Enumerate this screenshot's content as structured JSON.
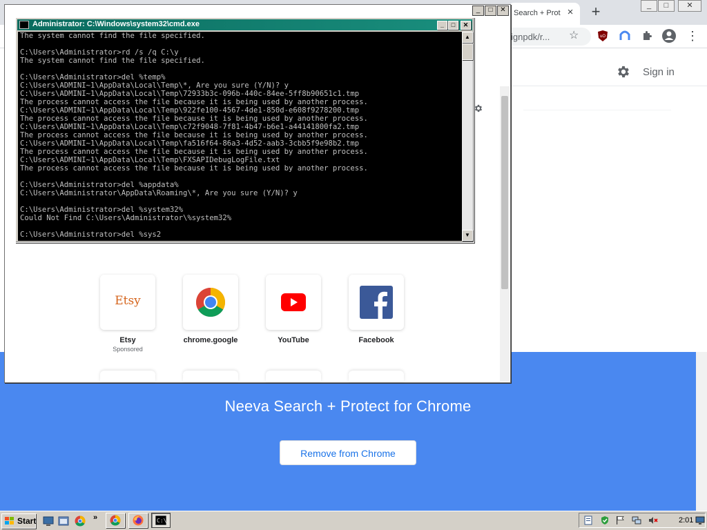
{
  "chrome": {
    "active_tab_title": "Search + Prot",
    "omnibox_text": "ignpdk/r...",
    "signin_label": "Sign in",
    "window_buttons": [
      "_",
      "□",
      "✕"
    ],
    "new_tab": "+"
  },
  "inner_window": {
    "window_buttons": [
      "_",
      "□",
      "✕"
    ],
    "shortcuts": [
      {
        "label": "Etsy",
        "sub": "Sponsored",
        "logo_text": "Etsy"
      },
      {
        "label": "chrome.google",
        "sub": ""
      },
      {
        "label": "YouTube",
        "sub": ""
      },
      {
        "label": "Facebook",
        "sub": ""
      }
    ]
  },
  "banner": {
    "title": "Neeva Search + Protect for Chrome",
    "remove_button": "Remove from Chrome",
    "color": "#4a88f0"
  },
  "cmd": {
    "title": "Administrator: C:\\Windows\\system32\\cmd.exe",
    "lines": [
      "The system cannot find the file specified.",
      "",
      "C:\\Users\\Administrator>rd /s /q C:\\y",
      "The system cannot find the file specified.",
      "",
      "C:\\Users\\Administrator>del %temp%",
      "C:\\Users\\ADMINI~1\\AppData\\Local\\Temp\\*, Are you sure (Y/N)? y",
      "C:\\Users\\ADMINI~1\\AppData\\Local\\Temp\\72933b3c-096b-440c-84ee-5ff8b90651c1.tmp",
      "The process cannot access the file because it is being used by another process.",
      "C:\\Users\\ADMINI~1\\AppData\\Local\\Temp\\922fe100-4567-4de1-850d-e608f9278200.tmp",
      "The process cannot access the file because it is being used by another process.",
      "C:\\Users\\ADMINI~1\\AppData\\Local\\Temp\\c72f9048-7f81-4b47-b6e1-a44141800fa2.tmp",
      "The process cannot access the file because it is being used by another process.",
      "C:\\Users\\ADMINI~1\\AppData\\Local\\Temp\\fa516f64-86a3-4d52-aab3-3cbb5f9e98b2.tmp",
      "The process cannot access the file because it is being used by another process.",
      "C:\\Users\\ADMINI~1\\AppData\\Local\\Temp\\FXSAPIDebugLogFile.txt",
      "The process cannot access the file because it is being used by another process.",
      "",
      "C:\\Users\\Administrator>del %appdata%",
      "C:\\Users\\Administrator\\AppData\\Roaming\\*, Are you sure (Y/N)? y",
      "",
      "C:\\Users\\Administrator>del %system32%",
      "Could Not Find C:\\Users\\Administrator\\%system32%",
      "",
      "C:\\Users\\Administrator>del %sys2"
    ],
    "window_buttons": [
      "_",
      "□",
      "✕"
    ]
  },
  "taskbar": {
    "start_label": "Start",
    "chevron": "»",
    "clock": "2:01"
  }
}
